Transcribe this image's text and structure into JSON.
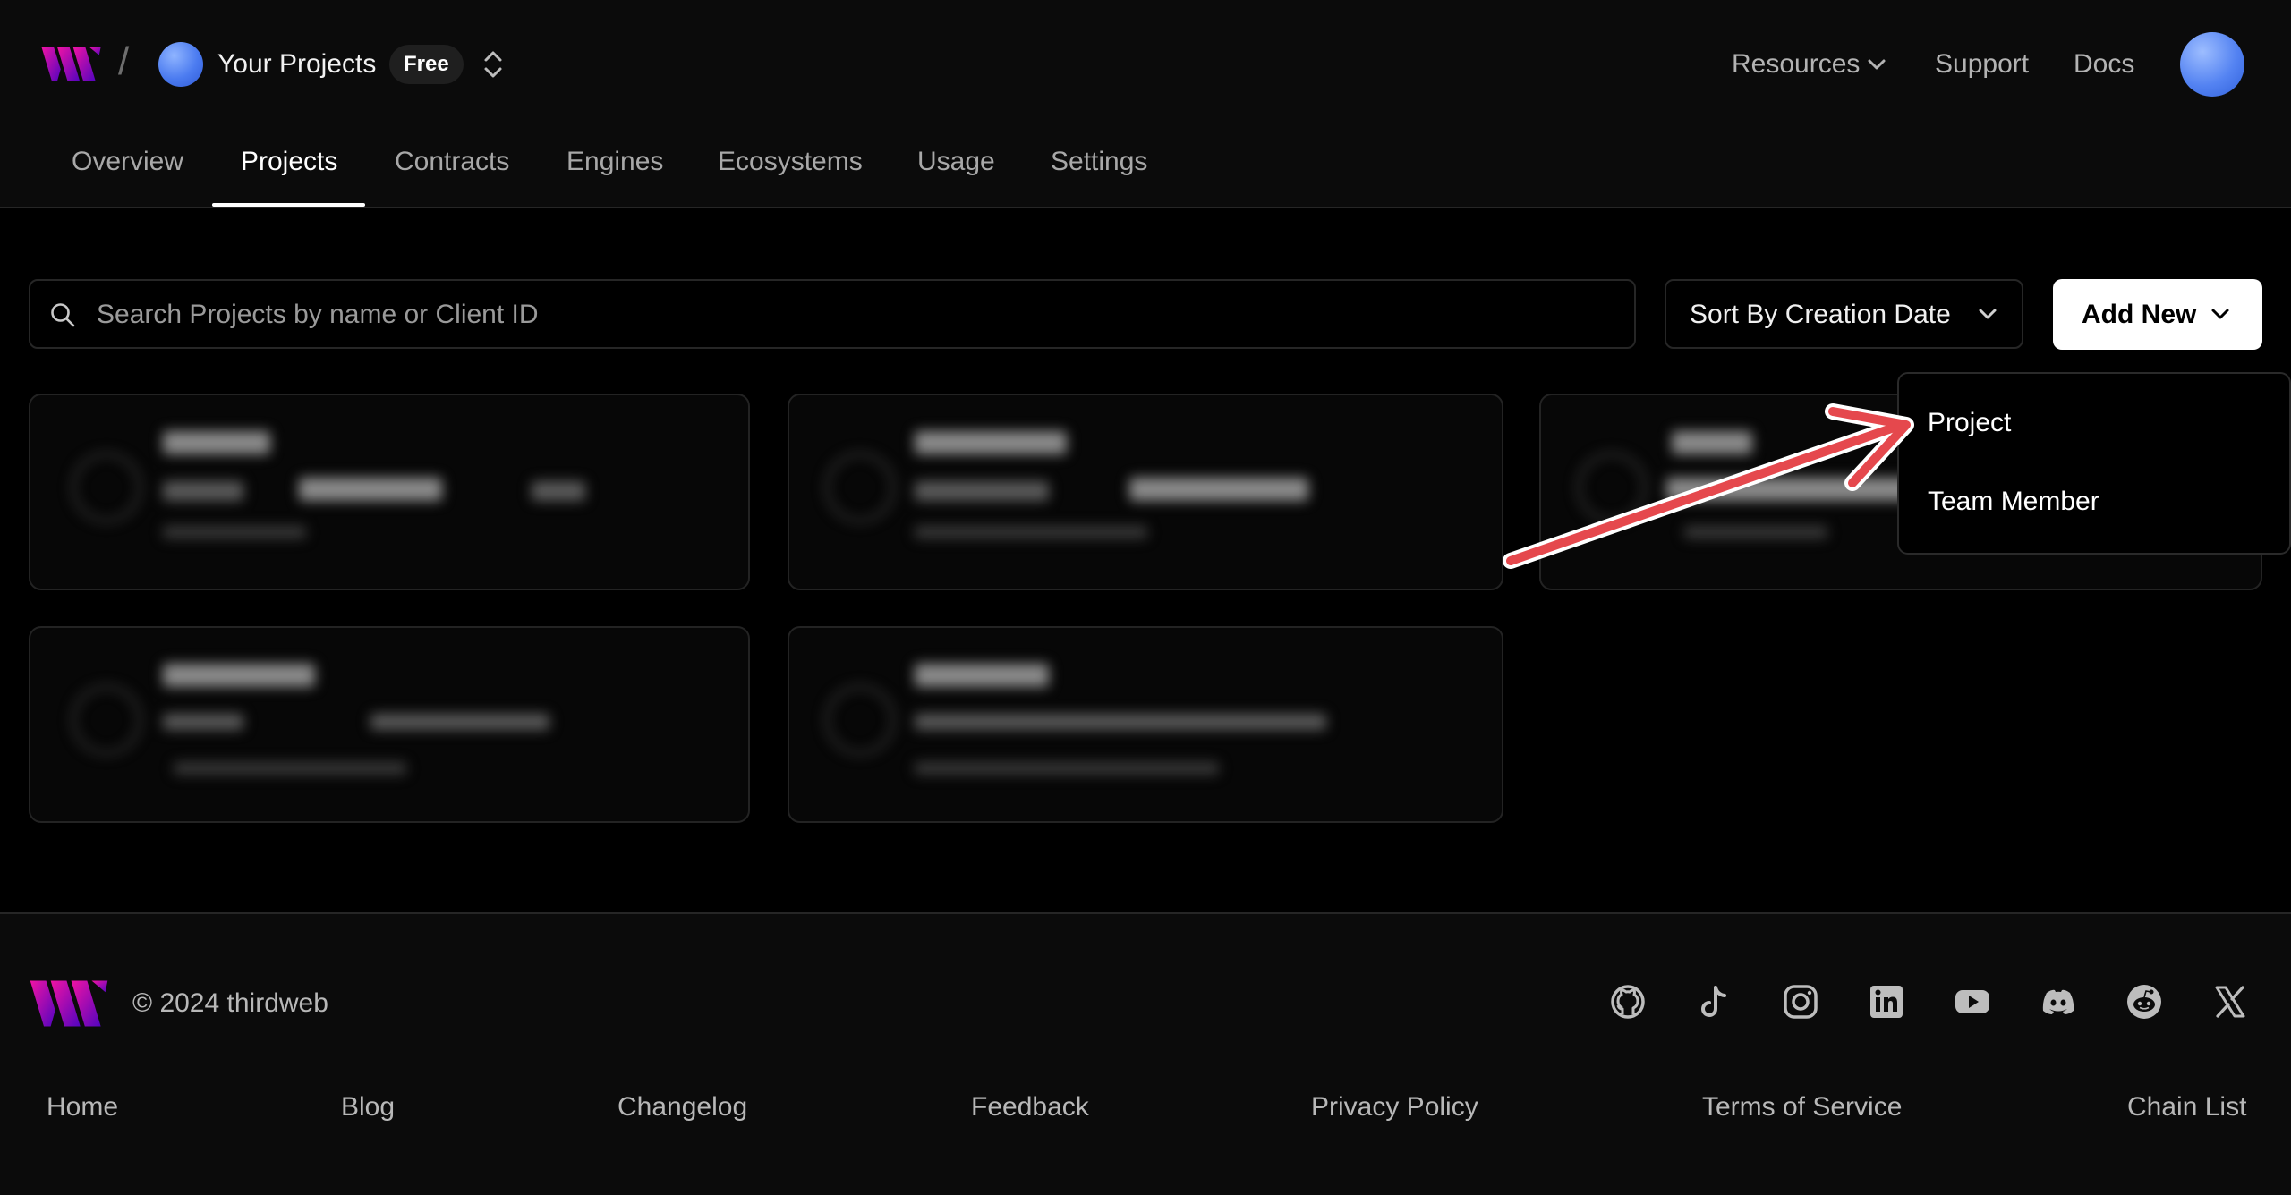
{
  "header": {
    "project_switcher": {
      "name": "Your Projects",
      "plan_badge": "Free"
    },
    "top_nav": {
      "resources": "Resources",
      "support": "Support",
      "docs": "Docs"
    },
    "tabs": [
      {
        "label": "Overview"
      },
      {
        "label": "Projects"
      },
      {
        "label": "Contracts"
      },
      {
        "label": "Engines"
      },
      {
        "label": "Ecosystems"
      },
      {
        "label": "Usage"
      },
      {
        "label": "Settings"
      }
    ],
    "active_tab": "Projects"
  },
  "toolbar": {
    "search": {
      "placeholder": "Search Projects by name or Client ID",
      "value": ""
    },
    "sort": {
      "label": "Sort By Creation Date"
    },
    "add_new": {
      "label": "Add New"
    }
  },
  "add_new_menu": {
    "items": [
      {
        "label": "Project"
      },
      {
        "label": "Team Member"
      }
    ]
  },
  "footer": {
    "copyright": "© 2024 thirdweb",
    "social_icons": [
      "github-icon",
      "tiktok-icon",
      "instagram-icon",
      "linkedin-icon",
      "youtube-icon",
      "discord-icon",
      "reddit-icon",
      "x-icon"
    ],
    "links": [
      {
        "label": "Home"
      },
      {
        "label": "Blog"
      },
      {
        "label": "Changelog"
      },
      {
        "label": "Feedback"
      },
      {
        "label": "Privacy Policy"
      },
      {
        "label": "Terms of Service"
      },
      {
        "label": "Chain List"
      }
    ]
  },
  "colors": {
    "background": "#000000",
    "surface": "#0b0b0b",
    "border": "#262626",
    "text_muted": "#b3b3b3",
    "brand_gradient_start": "#f213a4",
    "brand_gradient_end": "#5204bf",
    "avatar_blue": "#4b7bf0",
    "annotation_arrow": "#e5484d"
  }
}
